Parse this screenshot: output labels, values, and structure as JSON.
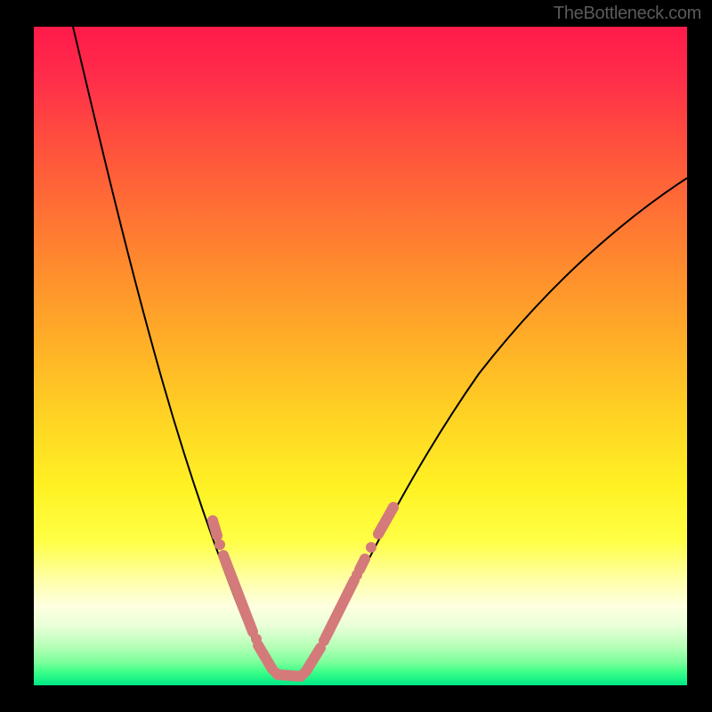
{
  "watermark": "TheBottleneck.com",
  "chart_data": {
    "type": "line",
    "title": "",
    "xlabel": "",
    "ylabel": "",
    "xlim": [
      0,
      100
    ],
    "ylim": [
      0,
      100
    ],
    "grid": false,
    "legend": false,
    "curve": [
      {
        "x": 6,
        "y": 100
      },
      {
        "x": 10,
        "y": 78
      },
      {
        "x": 14,
        "y": 60
      },
      {
        "x": 18,
        "y": 45
      },
      {
        "x": 22,
        "y": 32
      },
      {
        "x": 26,
        "y": 21
      },
      {
        "x": 30,
        "y": 12
      },
      {
        "x": 33,
        "y": 6
      },
      {
        "x": 36,
        "y": 2
      },
      {
        "x": 38,
        "y": 0.5
      },
      {
        "x": 40,
        "y": 0.5
      },
      {
        "x": 43,
        "y": 3
      },
      {
        "x": 47,
        "y": 10
      },
      {
        "x": 52,
        "y": 20
      },
      {
        "x": 58,
        "y": 30
      },
      {
        "x": 65,
        "y": 40
      },
      {
        "x": 74,
        "y": 50
      },
      {
        "x": 85,
        "y": 59
      },
      {
        "x": 100,
        "y": 68
      }
    ],
    "highlighted_points": [
      {
        "x": 27.5,
        "y": 25
      },
      {
        "x": 30,
        "y": 18
      },
      {
        "x": 31,
        "y": 15
      },
      {
        "x": 32,
        "y": 12
      },
      {
        "x": 33,
        "y": 9
      },
      {
        "x": 34,
        "y": 6.5
      },
      {
        "x": 35,
        "y": 4.5
      },
      {
        "x": 36,
        "y": 3
      },
      {
        "x": 37,
        "y": 1.8
      },
      {
        "x": 38,
        "y": 1
      },
      {
        "x": 39,
        "y": 0.7
      },
      {
        "x": 40,
        "y": 0.7
      },
      {
        "x": 41,
        "y": 1.2
      },
      {
        "x": 42,
        "y": 2
      },
      {
        "x": 43,
        "y": 3.2
      },
      {
        "x": 44,
        "y": 5
      },
      {
        "x": 45,
        "y": 7
      },
      {
        "x": 46,
        "y": 9
      },
      {
        "x": 47,
        "y": 11
      },
      {
        "x": 48,
        "y": 13
      },
      {
        "x": 49,
        "y": 15
      },
      {
        "x": 50,
        "y": 17
      },
      {
        "x": 53,
        "y": 22
      },
      {
        "x": 55,
        "y": 25.5
      }
    ],
    "colors": {
      "curve": "#000000",
      "points": "#d47a7a",
      "gradient_top": "#ff1a4a",
      "gradient_bottom": "#00e986"
    }
  }
}
